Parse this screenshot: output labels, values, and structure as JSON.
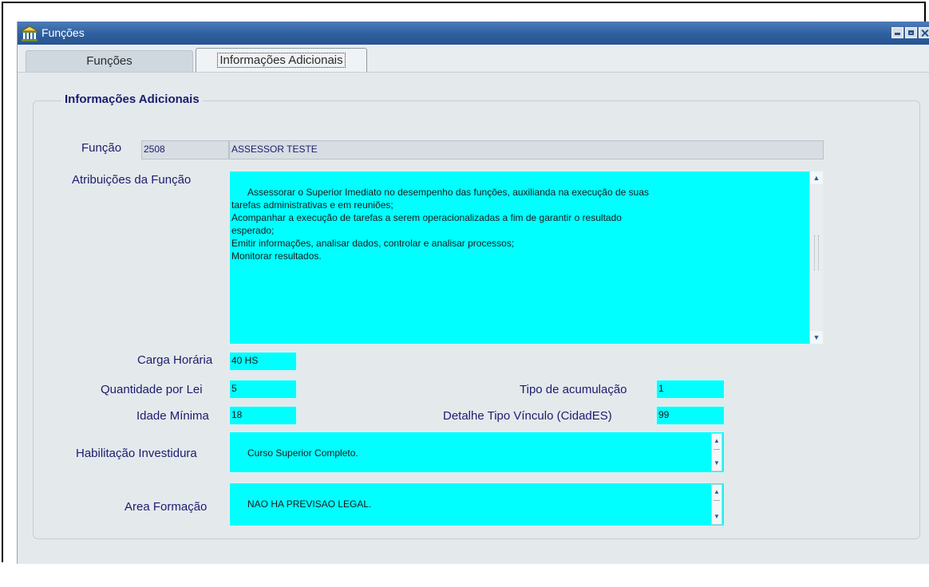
{
  "window": {
    "title": "Funções",
    "icon": "building-columns-icon"
  },
  "tabs": [
    {
      "label": "Funções",
      "active": false
    },
    {
      "label": "Informações Adicionais",
      "active": true
    }
  ],
  "group": {
    "title": "Informações Adicionais"
  },
  "fields": {
    "funcao": {
      "label": "Função",
      "code": "2508",
      "name": "ASSESSOR TESTE"
    },
    "atribuicoes": {
      "label": "Atribuições da Função",
      "value": "Assessorar o Superior Imediato no desempenho das funções, auxilianda na execução de suas\ntarefas administrativas e em reuniões;\nAcompanhar a execução de tarefas a serem operacionalizadas a fim de garantir o resultado\nesperado;\nEmitir informações, analisar dados, controlar e analisar processos;\nMonitorar resultados."
    },
    "carga_horaria": {
      "label": "Carga Horária",
      "value": "40 HS"
    },
    "quantidade_lei": {
      "label": "Quantidade por Lei",
      "value": "5"
    },
    "idade_minima": {
      "label": "Idade Mínima",
      "value": "18"
    },
    "tipo_acumulacao": {
      "label": "Tipo de acumulação",
      "value": "1"
    },
    "detalhe_vinculo": {
      "label": "Detalhe Tipo Vínculo (CidadES)",
      "value": "99"
    },
    "habilitacao": {
      "label": "Habilitação Investidura",
      "value": "Curso Superior Completo."
    },
    "area_formacao": {
      "label": "Area Formação",
      "value": "NAO HA PREVISAO LEGAL."
    }
  },
  "colors": {
    "input_active": "#00ffff",
    "label": "#1c1c6e",
    "titlebar": "#2f5f9f"
  }
}
